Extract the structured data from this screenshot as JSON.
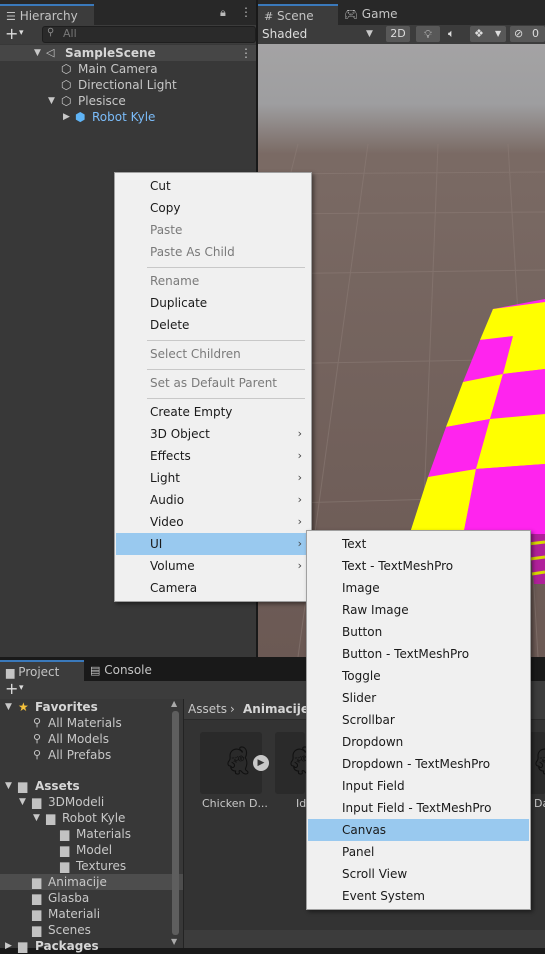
{
  "hierarchy": {
    "tab_label": "Hierarchy",
    "search_placeholder": "All",
    "scene_name": "SampleScene",
    "items": [
      {
        "label": "Main Camera"
      },
      {
        "label": "Directional Light"
      },
      {
        "label": "Plesisce"
      },
      {
        "label": "Robot Kyle"
      }
    ]
  },
  "scene_view": {
    "tabs": [
      {
        "label": "Scene"
      },
      {
        "label": "Game"
      }
    ],
    "shading_mode": "Shaded",
    "mode_2d": "2D",
    "hidden_count": "0",
    "colors": {
      "magenta": "#ff24ee",
      "yellow": "#ffff00"
    }
  },
  "context_menu": {
    "items": [
      {
        "label": "Cut"
      },
      {
        "label": "Copy"
      },
      {
        "label": "Paste"
      },
      {
        "label": "Paste As Child"
      },
      {
        "label": "Rename"
      },
      {
        "label": "Duplicate"
      },
      {
        "label": "Delete"
      },
      {
        "label": "Select Children"
      },
      {
        "label": "Set as Default Parent"
      },
      {
        "label": "Create Empty"
      },
      {
        "label": "3D Object"
      },
      {
        "label": "Effects"
      },
      {
        "label": "Light"
      },
      {
        "label": "Audio"
      },
      {
        "label": "Video"
      },
      {
        "label": "UI"
      },
      {
        "label": "Volume"
      },
      {
        "label": "Camera"
      }
    ],
    "highlighted": "UI",
    "highlight_color": "#99c9ef"
  },
  "ui_submenu": {
    "items": [
      {
        "label": "Text"
      },
      {
        "label": "Text - TextMeshPro"
      },
      {
        "label": "Image"
      },
      {
        "label": "Raw Image"
      },
      {
        "label": "Button"
      },
      {
        "label": "Button - TextMeshPro"
      },
      {
        "label": "Toggle"
      },
      {
        "label": "Slider"
      },
      {
        "label": "Scrollbar"
      },
      {
        "label": "Dropdown"
      },
      {
        "label": "Dropdown - TextMeshPro"
      },
      {
        "label": "Input Field"
      },
      {
        "label": "Input Field - TextMeshPro"
      },
      {
        "label": "Canvas"
      },
      {
        "label": "Panel"
      },
      {
        "label": "Scroll View"
      },
      {
        "label": "Event System"
      }
    ],
    "highlighted": "Canvas"
  },
  "project": {
    "tabs": [
      {
        "label": "Project"
      },
      {
        "label": "Console"
      }
    ],
    "favorites_label": "Favorites",
    "favorites": [
      {
        "label": "All Materials"
      },
      {
        "label": "All Models"
      },
      {
        "label": "All Prefabs"
      }
    ],
    "assets_label": "Assets",
    "tree": [
      {
        "label": "3DModeli"
      },
      {
        "label": "Robot Kyle"
      },
      {
        "label": "Materials"
      },
      {
        "label": "Model"
      },
      {
        "label": "Textures"
      },
      {
        "label": "Animacije"
      },
      {
        "label": "Glasba"
      },
      {
        "label": "Materiali"
      },
      {
        "label": "Scenes"
      },
      {
        "label": "Packages"
      }
    ],
    "breadcrumb": {
      "root": "Assets",
      "current": "Animacije"
    },
    "assets": [
      {
        "label": "Chicken D..."
      },
      {
        "label": "Idl"
      },
      {
        "label": "Da"
      }
    ]
  }
}
